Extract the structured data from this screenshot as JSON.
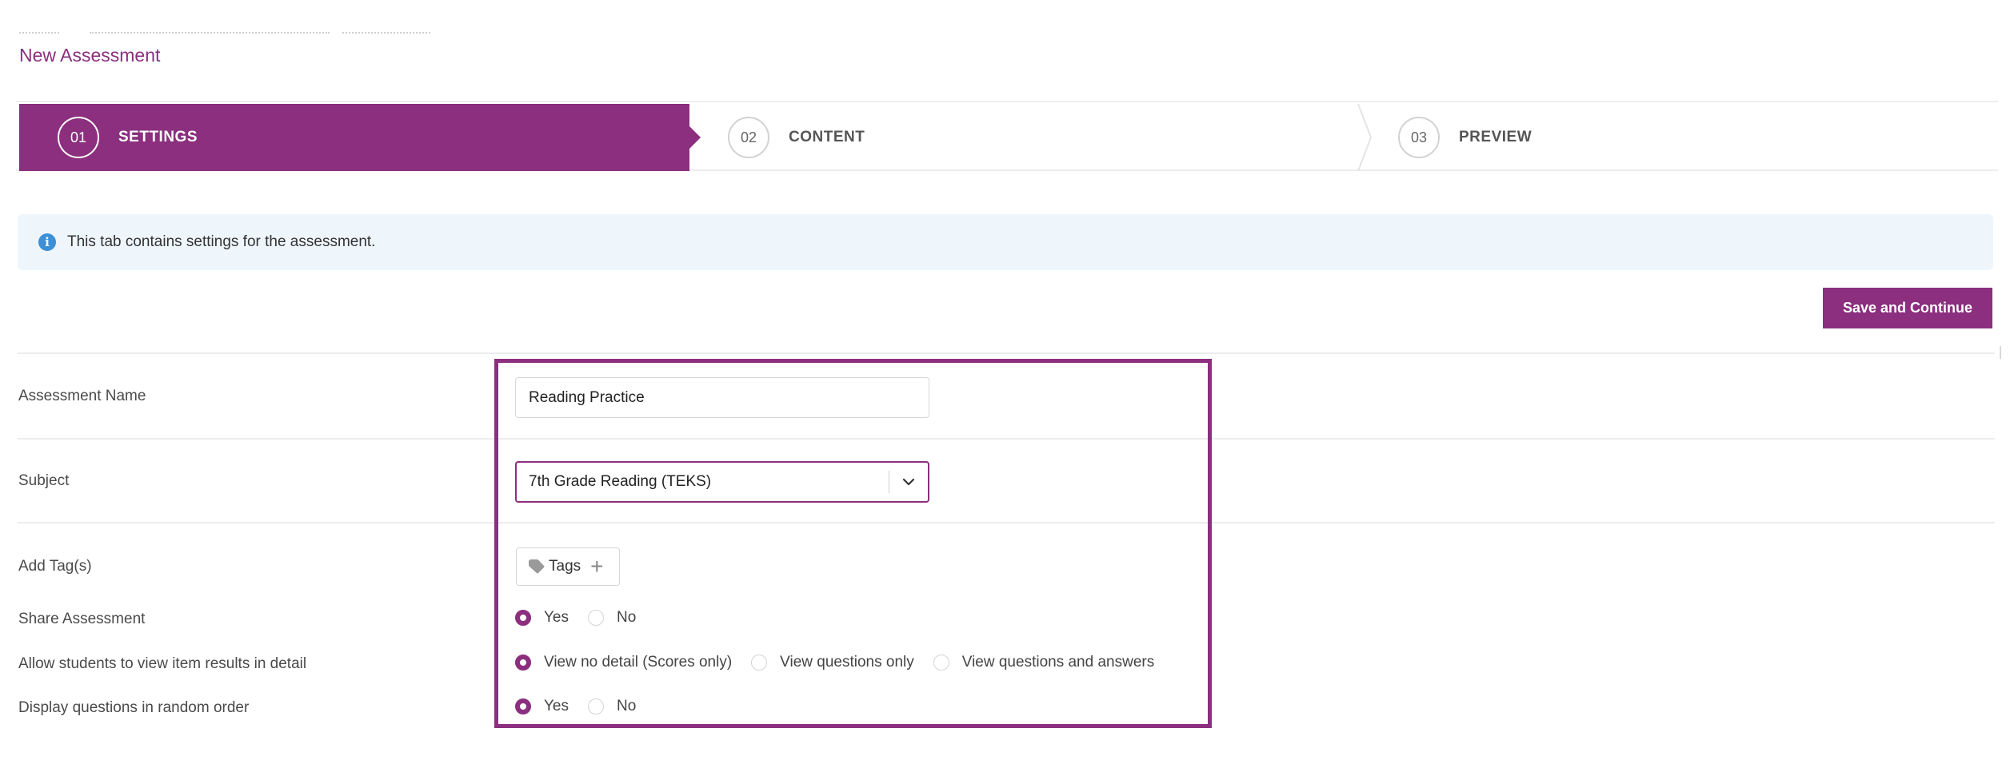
{
  "page": {
    "title": "New Assessment"
  },
  "stepper": {
    "steps": [
      {
        "number": "01",
        "label": "SETTINGS",
        "active": true
      },
      {
        "number": "02",
        "label": "CONTENT",
        "active": false
      },
      {
        "number": "03",
        "label": "PREVIEW",
        "active": false
      }
    ]
  },
  "info": {
    "icon": "info-icon",
    "text": "This tab contains settings for the assessment."
  },
  "actions": {
    "save_label": "Save and Continue"
  },
  "form": {
    "name": {
      "label": "Assessment Name",
      "value": "Reading Practice"
    },
    "subject": {
      "label": "Subject",
      "value": "7th Grade Reading (TEKS)"
    },
    "tags": {
      "label": "Add Tag(s)",
      "button": "Tags",
      "icon": "tag-icon"
    },
    "share": {
      "label": "Share Assessment",
      "options": [
        "Yes",
        "No"
      ],
      "selected": "Yes"
    },
    "item_results": {
      "label": "Allow students to view item results in detail",
      "options": [
        "View no detail (Scores only)",
        "View questions only",
        "View questions and answers"
      ],
      "selected": "View no detail (Scores only)"
    },
    "random_order": {
      "label": "Display questions in random order",
      "options": [
        "Yes",
        "No"
      ],
      "selected": "Yes"
    }
  },
  "colors": {
    "accent": "#8b2f7e",
    "info_bg": "#eef6fc",
    "info_icon": "#3d8fd6"
  }
}
